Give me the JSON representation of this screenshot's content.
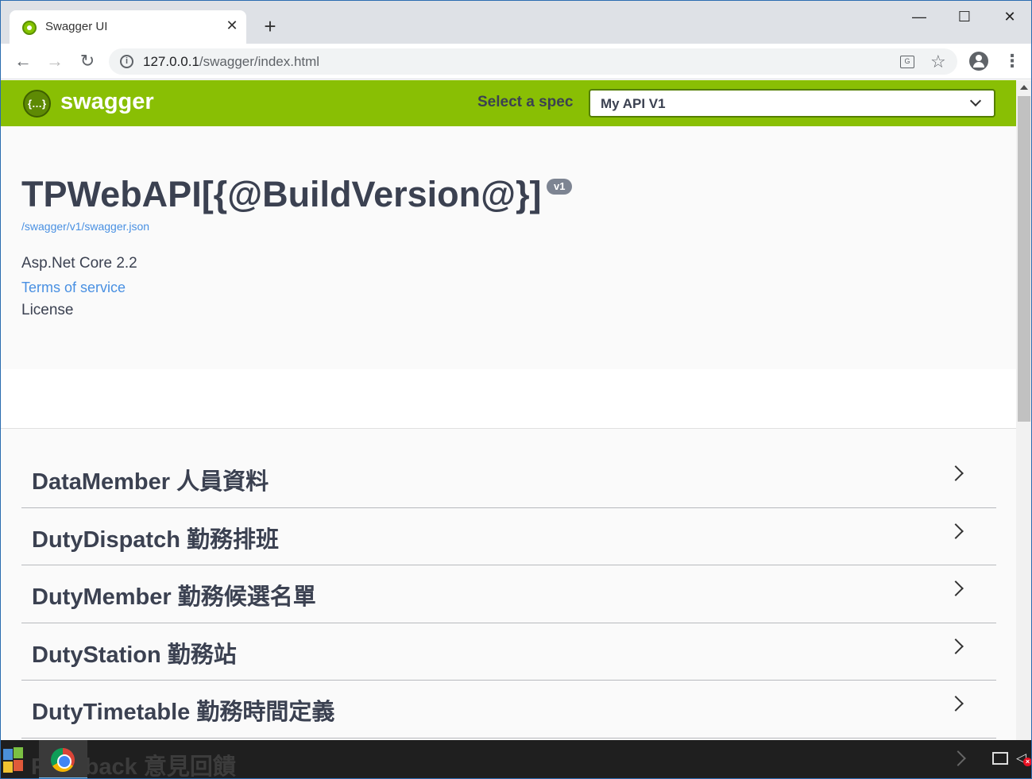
{
  "browser": {
    "tab_title": "Swagger UI",
    "url_host": "127.0.0.1",
    "url_path": "/swagger/index.html"
  },
  "swagger": {
    "brand": "swagger",
    "select_label": "Select a spec",
    "select_value": "My API V1",
    "title": "TPWebAPI[{@BuildVersion@}]",
    "version": "v1",
    "spec_link": "/swagger/v1/swagger.json",
    "description": "Asp.Net Core 2.2",
    "terms_link": "Terms of service",
    "license": "License",
    "tags": [
      {
        "label": "DataMember 人員資料"
      },
      {
        "label": "DutyDispatch 勤務排班"
      },
      {
        "label": "DutyMember 勤務候選名單"
      },
      {
        "label": "DutyStation 勤務站"
      },
      {
        "label": "DutyTimetable 勤務時間定義"
      }
    ],
    "partial_tag": "Feedback 意見回饋"
  },
  "colors": {
    "header_green": "#89bf04",
    "link_blue": "#4990e2",
    "text_dark": "#3b4151"
  }
}
